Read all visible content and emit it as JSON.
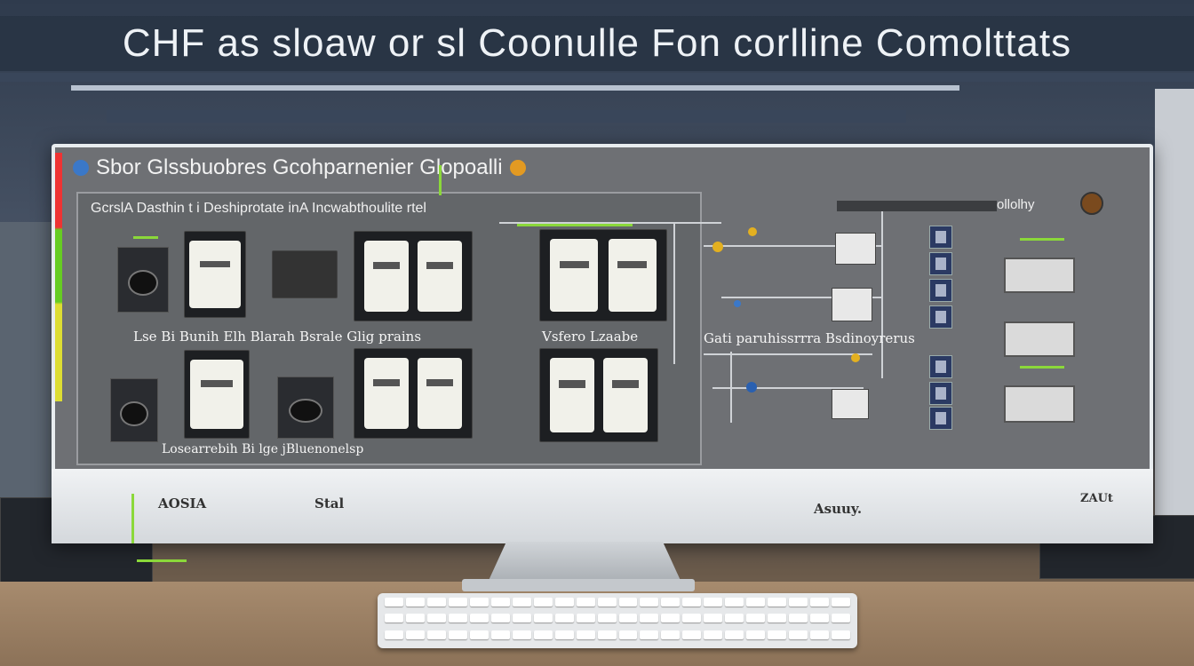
{
  "banner": {
    "title": "CHF as sloaw or sl Coonulle Fon corlline Comolttats"
  },
  "screen": {
    "header": "Sbor Glssbuobres Gcohparnenier Glopoalli",
    "left_panel_title": "GcrslA Dasthin t i Deshiprotate inA Incwabthoulite rtel",
    "right_header": "ollolhy",
    "captions": {
      "row1_left": "Lse Bi Bunih Elh Blarah Bsrale Glig prains",
      "row1_mid": "Vsfero Lzaabe",
      "row1_right": "Gati paruhissrrra Bsdinoyrerus",
      "row2_left": "Losearrebih Bi lge jBluenonelsp"
    }
  },
  "chin_labels": [
    "AOSIA",
    "Stal",
    "Asuuy.",
    "ZAUt"
  ],
  "icons": [
    "orange-badge-icon",
    "globe-icon",
    "power-icon"
  ],
  "colors": {
    "accent_green": "#8bd83a",
    "screen_bg": "#6e7074"
  }
}
